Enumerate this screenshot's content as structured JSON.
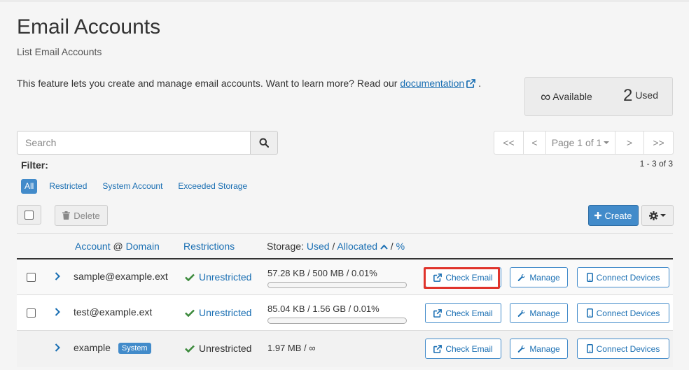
{
  "header": {
    "title": "Email Accounts",
    "subtitle": "List Email Accounts",
    "intro_text": "This feature lets you create and manage email accounts. Want to learn more? Read our ",
    "doc_link": "documentation",
    "intro_end": "."
  },
  "stats": {
    "available_value": "∞",
    "available_label": "Available",
    "used_value": "2",
    "used_label": "Used"
  },
  "search": {
    "placeholder": "Search"
  },
  "pagination": {
    "first": "<<",
    "prev": "<",
    "page_label": "Page 1 of 1",
    "next": ">",
    "last": ">>",
    "range": "1 - 3 of 3"
  },
  "filter": {
    "label": "Filter:",
    "options": [
      "All",
      "Restricted",
      "System Account",
      "Exceeded Storage"
    ],
    "active": "All"
  },
  "toolbar": {
    "delete_label": "Delete",
    "create_label": "Create"
  },
  "table": {
    "headers": {
      "account": "Account",
      "at": "@",
      "domain": "Domain",
      "restrictions": "Restrictions",
      "storage_prefix": "Storage:",
      "used": "Used",
      "slash1": "/",
      "allocated": "Allocated",
      "slash2": "/",
      "percent": "%"
    },
    "rows": [
      {
        "account": "sample@example.ext",
        "restriction": "Unrestricted",
        "storage": "57.28 KB / 500 MB / 0.01%",
        "usage_fraction": 0.0001,
        "check": "Check Email",
        "manage": "Manage",
        "connect": "Connect Devices"
      },
      {
        "account": "test@example.ext",
        "restriction": "Unrestricted",
        "storage": "85.04 KB / 1.56 GB / 0.01%",
        "usage_fraction": 0.0001,
        "check": "Check Email",
        "manage": "Manage",
        "connect": "Connect Devices"
      },
      {
        "account": "example",
        "badge": "System",
        "restriction": "Unrestricted",
        "storage": "1.97 MB / ∞",
        "check": "Check Email",
        "manage": "Manage",
        "connect": "Connect Devices"
      }
    ]
  },
  "colors": {
    "primary": "#428bca",
    "link": "#1a6fb3",
    "success": "#3c8a3c",
    "highlight": "#e0342c"
  }
}
